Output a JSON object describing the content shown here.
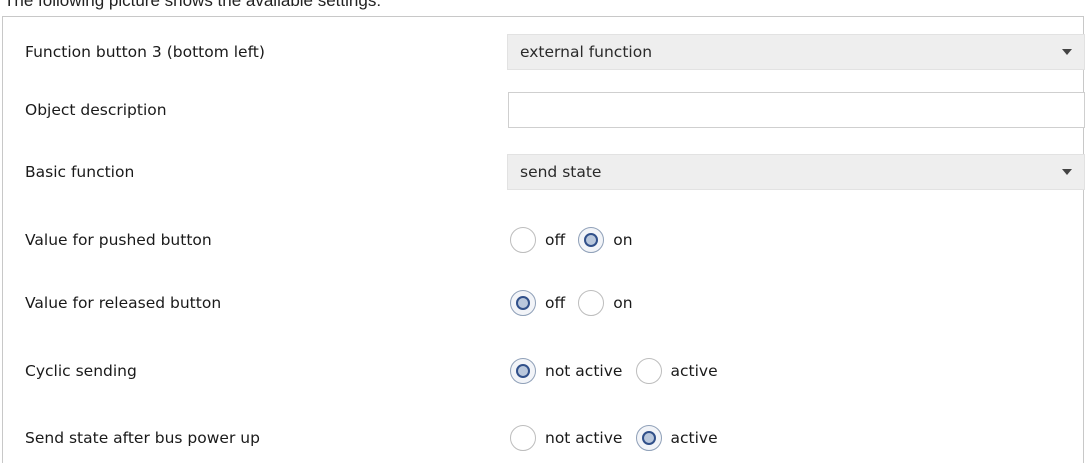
{
  "caption": "The following picture shows the available settings:",
  "rows": {
    "function_button": {
      "label": "Function button 3 (bottom left)",
      "value": "external function",
      "icon": "chevron-down-icon"
    },
    "object_description": {
      "label": "Object description",
      "value": ""
    },
    "basic_function": {
      "label": "Basic function",
      "value": "send state",
      "icon": "chevron-down-icon"
    },
    "pushed": {
      "label": "Value for pushed button",
      "options": [
        "off",
        "on"
      ],
      "selected": "on"
    },
    "released": {
      "label": "Value for released button",
      "options": [
        "off",
        "on"
      ],
      "selected": "off"
    },
    "cyclic": {
      "label": "Cyclic sending",
      "options": [
        "not active",
        "active"
      ],
      "selected": "not active"
    },
    "bus_power": {
      "label": "Send state after bus power up",
      "options": [
        "not active",
        "active"
      ],
      "selected": "active"
    }
  }
}
